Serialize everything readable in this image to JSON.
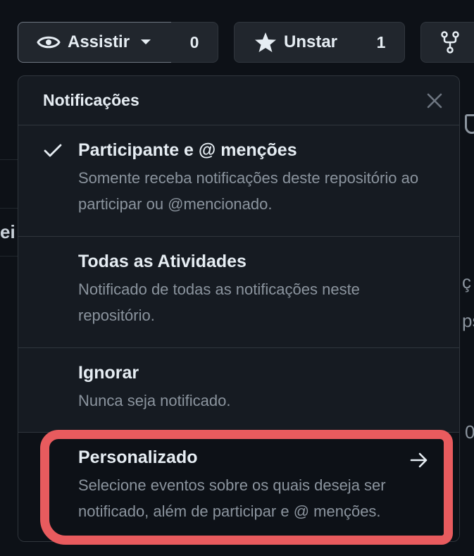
{
  "header": {
    "watch_label": "Assistir",
    "watch_count": "0",
    "star_label": "Unstar",
    "star_count": "1"
  },
  "background_fragments": {
    "left": "ei",
    "right_1": "ç",
    "right_2": "ps",
    "right_3": "0"
  },
  "notifications": {
    "title": "Notificações",
    "items": [
      {
        "title": "Participante e @ menções",
        "description": "Somente receba notificações deste repositório ao participar ou @mencionado.",
        "selected": true
      },
      {
        "title": "Todas as Atividades",
        "description": "Notificado de todas as notificações neste repositório."
      },
      {
        "title": "Ignorar",
        "description": "Nunca seja notificado."
      },
      {
        "title": "Personalizado",
        "description": "Selecione eventos sobre os quais deseja ser notificado, além de participar e @ menções."
      }
    ]
  },
  "colors": {
    "background": "#0d1117",
    "panel": "#161b22",
    "border": "#30363d",
    "muted_text": "#8b949e",
    "highlight_annotation": "#e85b5e"
  },
  "icons": {
    "watch": "eye-icon",
    "dropdown": "caret-down-icon",
    "star": "star-icon",
    "fork": "fork-icon",
    "close": "close-icon",
    "check": "check-icon",
    "arrow": "arrow-right-icon"
  }
}
